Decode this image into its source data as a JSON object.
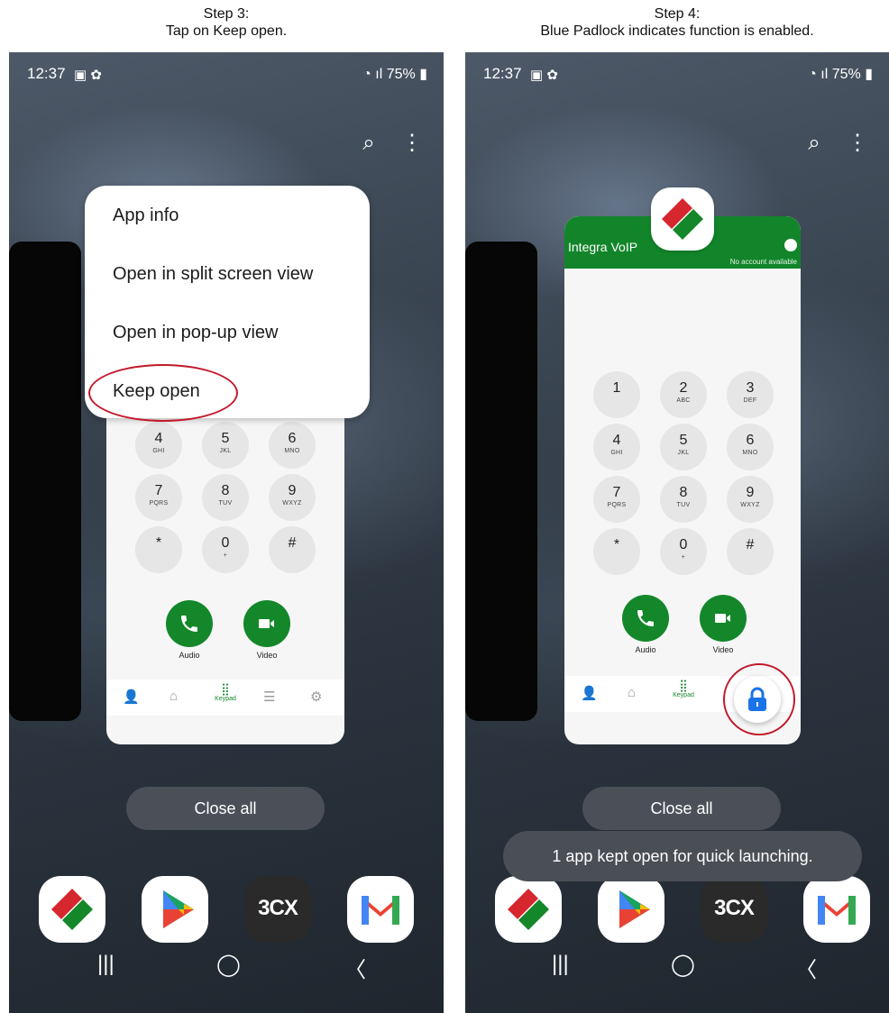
{
  "captions": {
    "left": {
      "line1": "Step 3:",
      "line2": "Tap on Keep open."
    },
    "right": {
      "line1": "Step 4:",
      "line2": "Blue Padlock indicates function is enabled."
    }
  },
  "status": {
    "time": "12:37",
    "battery": "75%"
  },
  "menu": {
    "items": [
      "App info",
      "Open in split screen view",
      "Open in pop-up view",
      "Keep open"
    ]
  },
  "app": {
    "title": "Integra VoIP",
    "subtitle": "No account available"
  },
  "keypad": [
    {
      "d": "1",
      "s": ""
    },
    {
      "d": "2",
      "s": "ABC"
    },
    {
      "d": "3",
      "s": "DEF"
    },
    {
      "d": "4",
      "s": "GHI"
    },
    {
      "d": "5",
      "s": "JKL"
    },
    {
      "d": "6",
      "s": "MNO"
    },
    {
      "d": "7",
      "s": "PQRS"
    },
    {
      "d": "8",
      "s": "TUV"
    },
    {
      "d": "9",
      "s": "WXYZ"
    },
    {
      "d": "*",
      "s": ""
    },
    {
      "d": "0",
      "s": "+"
    },
    {
      "d": "#",
      "s": ""
    }
  ],
  "calls": {
    "audio": "Audio",
    "video": "Video"
  },
  "nav": {
    "keypad": "Keypad"
  },
  "close_all": "Close all",
  "toast": "1 app kept open for quick launching.",
  "dock": {
    "threecx": "3CX"
  },
  "colors": {
    "accent_green": "#13872a",
    "lock_blue": "#1a73e8",
    "highlight_red": "#c2182b"
  }
}
